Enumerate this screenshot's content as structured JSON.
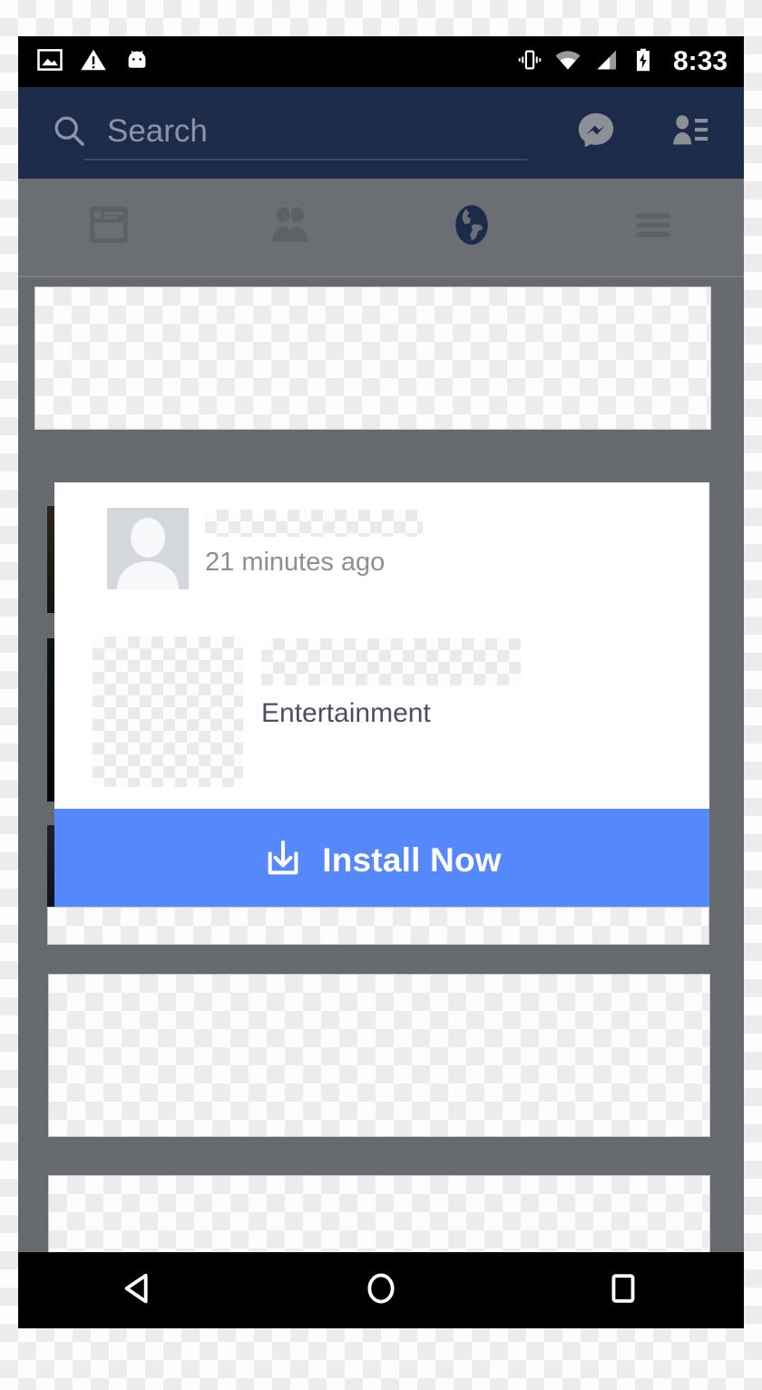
{
  "status_bar": {
    "time": "8:33",
    "left_icons": [
      {
        "name": "image-icon",
        "label": "photo"
      },
      {
        "name": "warning-icon",
        "label": "warning"
      },
      {
        "name": "android-icon",
        "label": "android"
      }
    ],
    "right_icons": [
      {
        "name": "vibrate-icon",
        "label": "vibrate"
      },
      {
        "name": "wifi-icon",
        "label": "wifi"
      },
      {
        "name": "cell-signal-icon",
        "label": "signal"
      },
      {
        "name": "battery-charging-icon",
        "label": "battery charging"
      }
    ],
    "background_color": "#000000",
    "text_color": "#ffffff"
  },
  "header": {
    "search_placeholder": "Search",
    "search_value": "",
    "background_color": "#1d2b4b",
    "actions": [
      {
        "name": "messenger-icon",
        "label": "Messenger"
      },
      {
        "name": "friend-requests-icon",
        "label": "Friend Requests"
      }
    ]
  },
  "tab_bar": {
    "active_index": 2,
    "tabs": [
      {
        "name": "news-feed-tab",
        "label": "News Feed",
        "icon": "newsfeed-icon",
        "active": false
      },
      {
        "name": "friends-tab",
        "label": "Friend Requests",
        "icon": "friends-icon",
        "active": false
      },
      {
        "name": "notifications-tab",
        "label": "Notifications",
        "icon": "globe-icon",
        "active": true
      },
      {
        "name": "menu-tab",
        "label": "More",
        "icon": "hamburger-icon",
        "active": false
      }
    ]
  },
  "ad_card": {
    "advertiser_name": "",
    "timestamp": "21 minutes ago",
    "app_name": "",
    "app_category": "Entertainment",
    "cta": {
      "label": "Install Now",
      "icon": "download-icon",
      "background_color": "#5589fb",
      "text_color": "#ffffff"
    },
    "avatar": "default-avatar-placeholder"
  },
  "feed_placeholders": [
    {
      "name": "feed-card-top",
      "content": "redacted"
    },
    {
      "name": "feed-strip",
      "content": "redacted"
    },
    {
      "name": "feed-card-middle",
      "content": "redacted"
    },
    {
      "name": "feed-card-bottom",
      "content": "redacted"
    }
  ],
  "nav_bar": {
    "buttons": [
      {
        "name": "back-button",
        "label": "Back",
        "icon": "triangle-left-icon"
      },
      {
        "name": "home-button",
        "label": "Home",
        "icon": "circle-icon"
      },
      {
        "name": "recents-button",
        "label": "Recents",
        "icon": "square-icon"
      }
    ],
    "background_color": "#000000"
  }
}
